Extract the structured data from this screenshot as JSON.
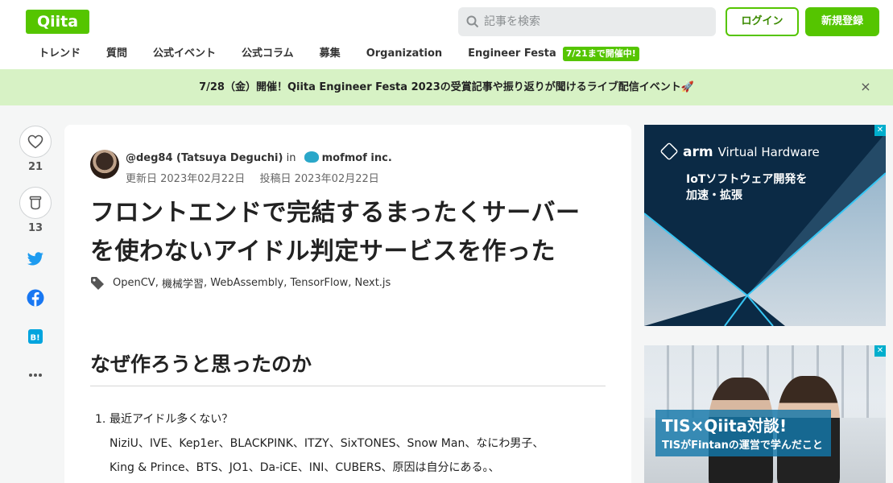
{
  "header": {
    "logo": "Qiita",
    "search_placeholder": "記事を検索",
    "login_label": "ログイン",
    "signup_label": "新規登録",
    "nav": [
      "トレンド",
      "質問",
      "公式イベント",
      "公式コラム",
      "募集",
      "Organization",
      "Engineer Festa"
    ],
    "nav_badge": "7/21まで開催中!"
  },
  "banner": {
    "text": "7/28（金）開催！Qiita Engineer Festa 2023の受賞記事や振り返りが聞けるライブ配信イベント🚀",
    "close": "×"
  },
  "actions": {
    "like_count": "21",
    "stock_count": "13"
  },
  "article": {
    "author": "@deg84 (Tatsuya Deguchi)",
    "in_label": "in",
    "org": "mofmof inc.",
    "updated": "更新日 2023年02月22日",
    "posted": "投稿日 2023年02月22日",
    "title_line1": "フロントエンドで完結するまったくサーバー",
    "title_line2": "を使わないアイドル判定サービスを作った",
    "tags": [
      "OpenCV",
      "機械学習",
      "WebAssembly",
      "TensorFlow",
      "Next.js"
    ],
    "section_heading": "なぜ作ろうと思ったのか",
    "list_num": "1.",
    "list_item1": "最近アイドル多くない？",
    "list_line2": "NiziU、IVE、Kep1er、BLACKPINK、ITZY、SixTONES、Snow Man、なにわ男子、",
    "list_line3": "King & Prince、BTS、JO1、Da-iCE、INI、CUBERS、原因は自分にある。、"
  },
  "ads": {
    "ad1_brand": "arm",
    "ad1_product": "Virtual Hardware",
    "ad1_line1": "IoTソフトウェア開発を",
    "ad1_line2": "加速・拡張",
    "ad2_line1": "TIS×Qiita対談!",
    "ad2_line2": "TISがFintanの運営で学んだこと"
  },
  "colors": {
    "brand": "#55c500",
    "banner_bg": "#d7f2c5",
    "twitter": "#1d9bf0",
    "facebook": "#1877f2",
    "hatena": "#00a4de"
  }
}
